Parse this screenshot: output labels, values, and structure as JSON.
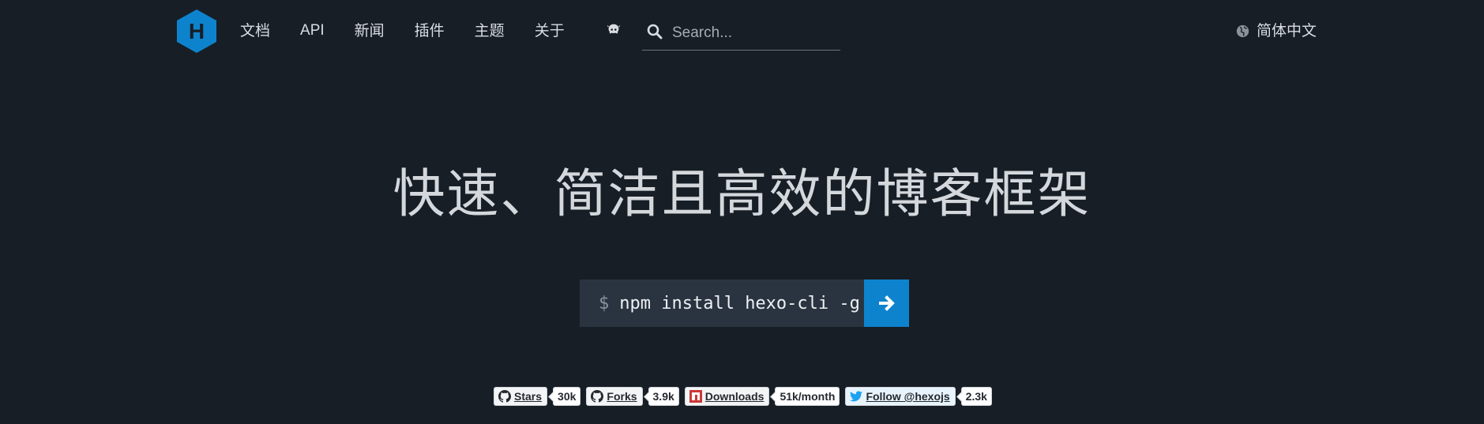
{
  "header": {
    "logo_letter": "H",
    "nav": [
      "文档",
      "API",
      "新闻",
      "插件",
      "主题",
      "关于"
    ],
    "search_placeholder": "Search...",
    "language": "简体中文"
  },
  "hero": {
    "headline": "快速、简洁且高效的博客框架",
    "install_prompt": "$",
    "install_command": "npm install hexo-cli -g"
  },
  "badges": [
    {
      "label": "Stars",
      "count": "30k",
      "icon": "github-icon"
    },
    {
      "label": "Forks",
      "count": "3.9k",
      "icon": "github-icon"
    },
    {
      "label": "Downloads",
      "count": "51k/month",
      "icon": "npm-icon"
    },
    {
      "label": "Follow @hexojs",
      "count": "2.3k",
      "icon": "twitter-icon"
    }
  ],
  "colors": {
    "background": "#171e26",
    "accent": "#0e83cd",
    "command_bg": "#2a3441"
  }
}
